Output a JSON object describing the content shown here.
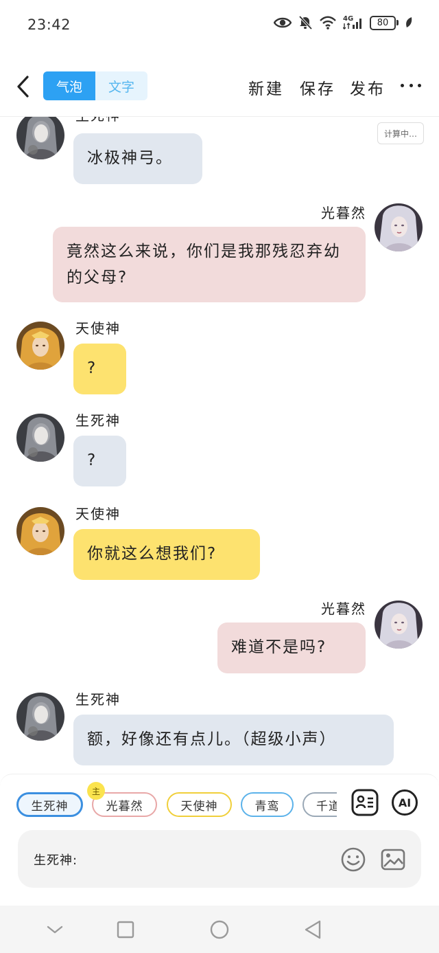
{
  "status_bar": {
    "time": "23:42",
    "network_label": "4G",
    "battery": "80",
    "icons": [
      "eye-icon",
      "bell-off-icon",
      "wifi-icon",
      "signal-icon",
      "battery-icon",
      "leaf-icon"
    ]
  },
  "toolbar": {
    "back_icon": "chevron-left-icon",
    "tab_bubble": "气泡",
    "tab_text": "文字",
    "new_label": "新建",
    "save_label": "保存",
    "publish_label": "发布",
    "more_icon": "more-icon"
  },
  "chat": {
    "calc_label": "计算中…",
    "messages": [
      {
        "sender": "生死神",
        "text": "冰极神弓。"
      },
      {
        "sender": "光暮然",
        "text": "竟然这么来说，你们是我那残忍弃幼的父母?"
      },
      {
        "sender": "天使神",
        "text": "?"
      },
      {
        "sender": "生死神",
        "text": "?"
      },
      {
        "sender": "天使神",
        "text": "你就这么想我们?"
      },
      {
        "sender": "光暮然",
        "text": "难道不是吗?"
      },
      {
        "sender": "生死神",
        "text": "额，好像还有点儿。（超级小声）"
      }
    ]
  },
  "character_bar": {
    "chips": [
      "生死神",
      "光暮然",
      "天使神",
      "青鸾",
      "千道"
    ],
    "main_badge": "主",
    "ai_label": "AI",
    "card_icon": "contact-card-icon"
  },
  "input": {
    "prefix": "生死神:",
    "emoji_icon": "smiley-icon",
    "image_icon": "image-icon"
  },
  "nav": {
    "icons": [
      "chevron-down-icon",
      "square-icon",
      "circle-icon",
      "triangle-back-icon"
    ]
  },
  "colors": {
    "accent": "#2da1f3",
    "bubble_gray": "#e1e7ef",
    "bubble_pink": "#f2dbdb",
    "bubble_yellow": "#fde26f"
  }
}
